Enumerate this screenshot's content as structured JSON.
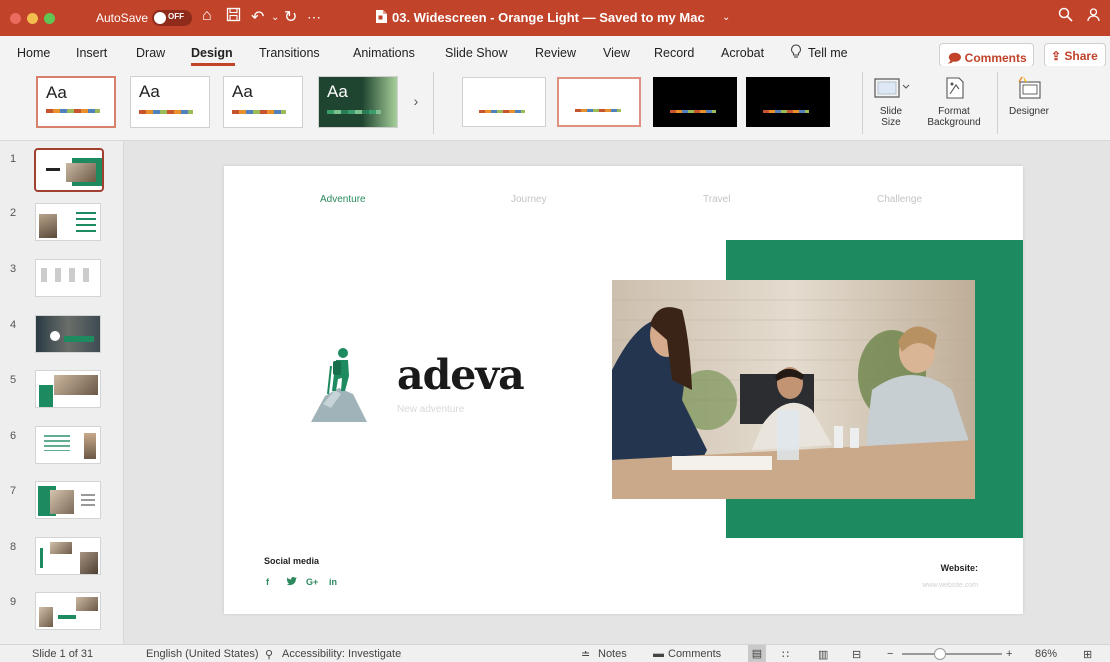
{
  "titlebar": {
    "autosave_label": "AutoSave",
    "autosave_state": "OFF",
    "document_title": "03. Widescreen - Orange Light — Saved to my Mac",
    "accent": "#c0432a"
  },
  "menu": {
    "tabs": [
      "Home",
      "Insert",
      "Draw",
      "Design",
      "Transitions",
      "Animations",
      "Slide Show",
      "Review",
      "View",
      "Record",
      "Acrobat",
      "Tell me"
    ],
    "active_tab": "Design",
    "comments_label": "Comments",
    "share_label": "Share"
  },
  "ribbon": {
    "theme_sample_text": "Aa",
    "slide_size": [
      "Slide",
      "Size"
    ],
    "format_background": [
      "Format",
      "Background"
    ],
    "designer": "Designer"
  },
  "thumbnails": {
    "numbers": [
      "1",
      "2",
      "3",
      "4",
      "5",
      "6",
      "7",
      "8",
      "9"
    ],
    "selected": "1"
  },
  "slide": {
    "nav": [
      "Adventure",
      "Journey",
      "Travel",
      "Challenge"
    ],
    "active_nav": "Adventure",
    "brand": "adeva",
    "tagline": "New adventure",
    "social_label": "Social media",
    "social_icons": [
      "f",
      "t",
      "G+",
      "in"
    ],
    "website_label": "Website:",
    "website_url": "www.website.com",
    "green": "#1e8a5f"
  },
  "status": {
    "slide_counter": "Slide 1 of 31",
    "language": "English (United States)",
    "accessibility": "Accessibility: Investigate",
    "notes": "Notes",
    "comments": "Comments",
    "zoom": "86%"
  }
}
